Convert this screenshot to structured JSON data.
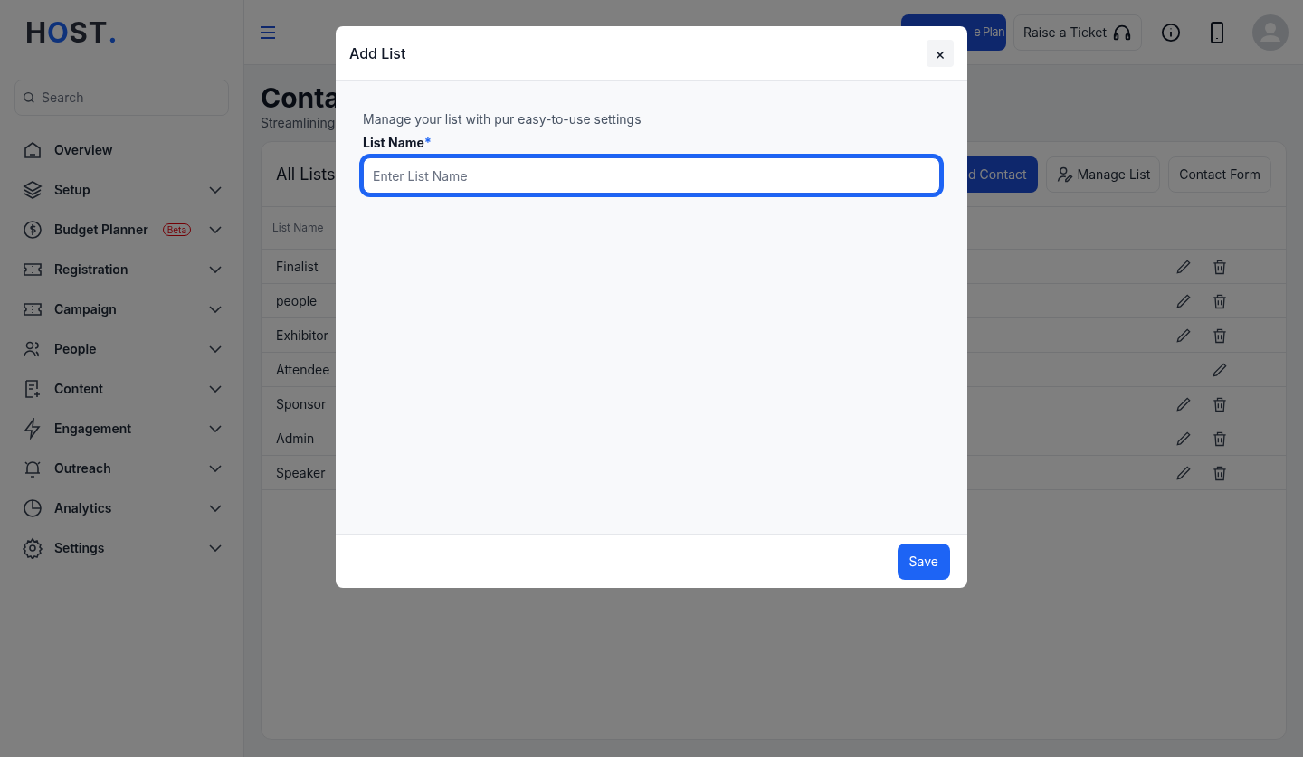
{
  "logo": [
    {
      "text": "H",
      "accent": false
    },
    {
      "text": "O",
      "accent": true
    },
    {
      "text": "ST",
      "accent": false
    },
    {
      "text": ".",
      "accent": true
    }
  ],
  "sidebar": {
    "search": {
      "placeholder": "Search"
    },
    "items": [
      {
        "label": "Overview",
        "expandable": false
      },
      {
        "label": "Setup",
        "expandable": true
      },
      {
        "label": "Budget Planner",
        "badge": "Beta",
        "expandable": true
      },
      {
        "label": "Registration",
        "expandable": true
      },
      {
        "label": "Campaign",
        "expandable": true
      },
      {
        "label": "People",
        "expandable": true
      },
      {
        "label": "Content",
        "expandable": true
      },
      {
        "label": "Engagement",
        "expandable": true
      },
      {
        "label": "Outreach",
        "expandable": true
      },
      {
        "label": "Analytics",
        "expandable": true
      },
      {
        "label": "Settings",
        "expandable": true
      }
    ]
  },
  "header": {
    "plan_button": "e Plan",
    "ticket_button": "Raise a Ticket"
  },
  "page": {
    "title": "Conta",
    "subtitle": "Streamlining"
  },
  "card": {
    "title": "All Lists",
    "buttons": [
      {
        "label": "d Contact",
        "kind": "primary"
      },
      {
        "label": "Manage List",
        "kind": "icon"
      },
      {
        "label": "Contact Form",
        "kind": "plain"
      }
    ],
    "columns": [
      "List Name"
    ],
    "rows": [
      {
        "name": "Finalist",
        "deletable": true
      },
      {
        "name": "people",
        "deletable": true
      },
      {
        "name": "Exhibitor",
        "deletable": true
      },
      {
        "name": "Attendee",
        "deletable": false
      },
      {
        "name": "Sponsor",
        "deletable": true
      },
      {
        "name": "Admin",
        "deletable": true
      },
      {
        "name": "Speaker",
        "deletable": true
      }
    ]
  },
  "modal": {
    "title": "Add List",
    "close": "×",
    "description": "Manage your list with pur easy-to-use settings",
    "field_label": "List Name",
    "required_mark": "*",
    "placeholder": "Enter List Name",
    "save": "Save"
  }
}
